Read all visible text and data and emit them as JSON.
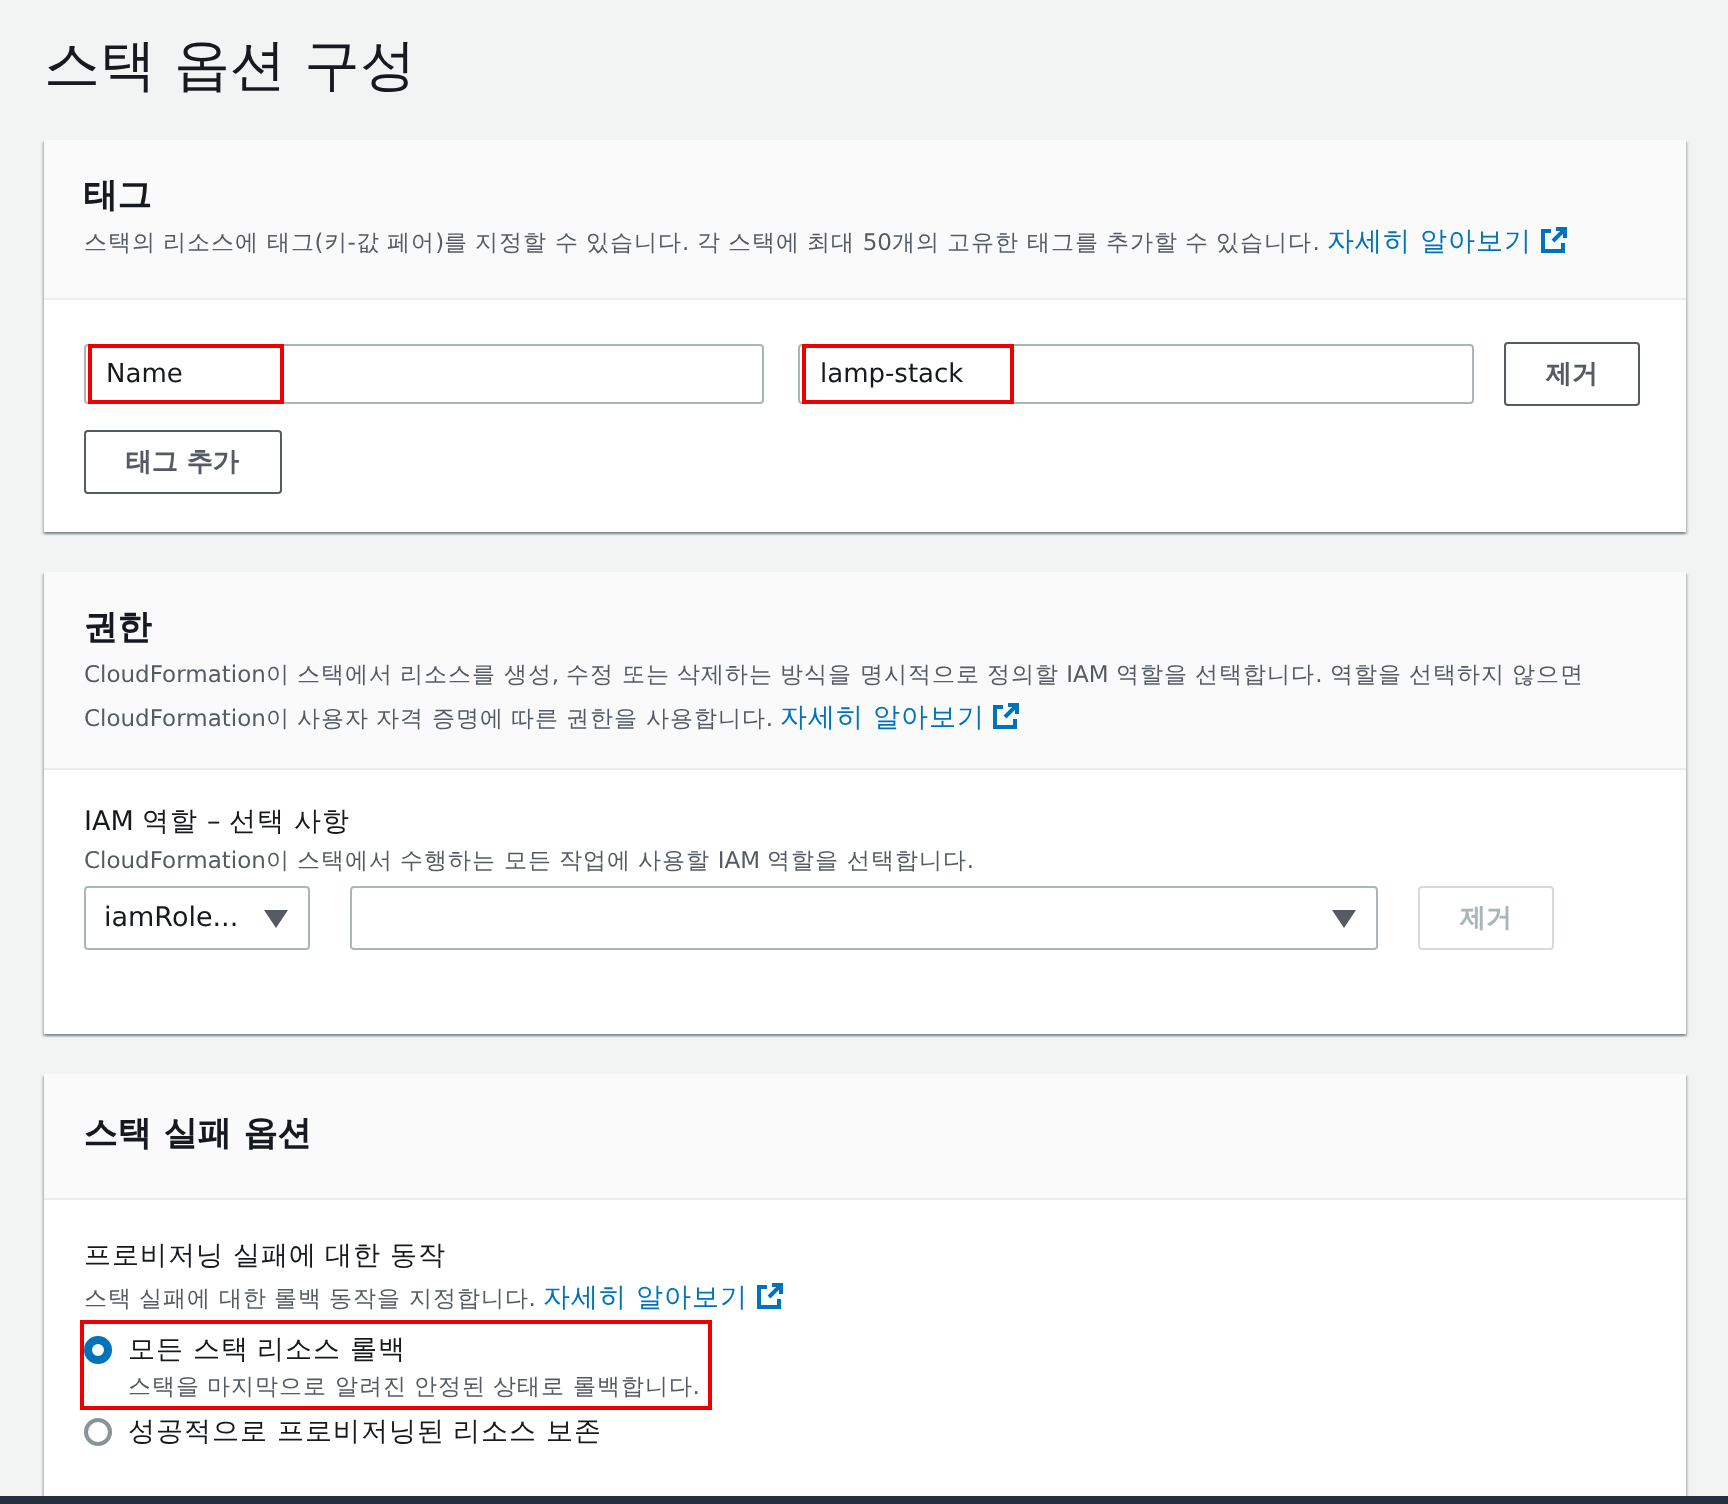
{
  "page_title": "스택 옵션 구성",
  "tags_section": {
    "title": "태그",
    "description": "스택의 리소스에 태그(키-값 페어)를 지정할 수 있습니다. 각 스택에 최대 50개의 고유한 태그를 추가할 수 있습니다.",
    "link": "자세히 알아보기",
    "tags": [
      {
        "key": "Name",
        "key_highlighted": true,
        "value": "lamp-stack",
        "value_highlighted": true,
        "remove_button": "제거"
      }
    ],
    "add_button": "태그 추가"
  },
  "permissions_section": {
    "title": "권한",
    "description": "CloudFormation이 스택에서 리소스를 생성, 수정 또는 삭제하는 방식을 명시적으로 정의할 IAM 역할을 선택합니다. 역할을 선택하지 않으면 CloudFormation이 사용자 자격 증명에 따른 권한을 사용합니다.",
    "link": "자세히 알아보기",
    "field_label": "IAM 역할 – 선택 사항",
    "field_description": "CloudFormation이 스택에서 수행하는 모든 작업에 사용할 IAM 역할을 선택합니다.",
    "type_select": "iamRole...",
    "remove_button": {
      "label": "제거",
      "disabled": true
    }
  },
  "failure_section": {
    "title": "스택 실패 옵션",
    "field_label": "프로비저닝 실패에 대한 동작",
    "field_description": "스택 실패에 대한 롤백 동작을 지정합니다.",
    "link": "자세히 알아보기",
    "options": [
      {
        "label": "모든 스택 리소스 롤백",
        "description": "스택을 마지막으로 알려진 안정된 상태로 롤백합니다.",
        "selected": true,
        "highlighted": true
      },
      {
        "label": "성공적으로 프로비저닝된 리소스 보존",
        "selected": false,
        "highlighted": false
      }
    ]
  }
}
